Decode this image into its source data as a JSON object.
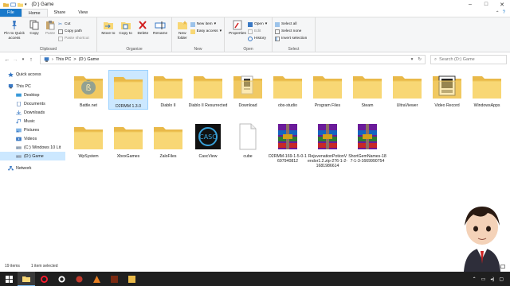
{
  "window": {
    "title": "(D:) Game",
    "drive_label": "(D:) Game"
  },
  "tabs": [
    "File",
    "Home",
    "Share",
    "View"
  ],
  "ribbon": {
    "clipboard": {
      "label": "Clipboard",
      "pin": "Pin to Quick access",
      "copy": "Copy",
      "paste": "Paste",
      "cut": "Cut",
      "copy_path": "Copy path",
      "paste_shortcut": "Paste shortcut"
    },
    "organize": {
      "label": "Organize",
      "move_to": "Move to",
      "copy_to": "Copy to",
      "delete": "Delete",
      "rename": "Rename"
    },
    "new": {
      "label": "New",
      "new_folder": "New folder",
      "new_item": "New item",
      "easy_access": "Easy access"
    },
    "open": {
      "label": "Open",
      "properties": "Properties",
      "open": "Open",
      "edit": "Edit",
      "history": "History"
    },
    "select": {
      "label": "Select",
      "select_all": "Select all",
      "select_none": "Select none",
      "invert": "Invert selection"
    }
  },
  "address": {
    "path": [
      "This PC",
      "(D:) Game"
    ],
    "separator": ">"
  },
  "search": {
    "placeholder": "Search (D:) Game"
  },
  "nav": {
    "items": [
      {
        "label": "Quick access",
        "icon": "star-icon",
        "indent": 0
      },
      {
        "label": "This PC",
        "icon": "computer-icon",
        "indent": 0
      },
      {
        "label": "Desktop",
        "icon": "desktop-icon",
        "indent": 1
      },
      {
        "label": "Documents",
        "icon": "documents-icon",
        "indent": 1
      },
      {
        "label": "Downloads",
        "icon": "downloads-icon",
        "indent": 1
      },
      {
        "label": "Music",
        "icon": "music-icon",
        "indent": 1
      },
      {
        "label": "Pictures",
        "icon": "pictures-icon",
        "indent": 1
      },
      {
        "label": "Videos",
        "icon": "videos-icon",
        "indent": 1
      },
      {
        "label": "(C:) Windows 10 Lit",
        "icon": "drive-icon",
        "indent": 1
      },
      {
        "label": "(D:) Game",
        "icon": "drive-icon",
        "indent": 1,
        "selected": true
      },
      {
        "label": "Network",
        "icon": "network-icon",
        "indent": 0
      }
    ]
  },
  "files": [
    {
      "name": "Battle.net",
      "type": "folder",
      "overlay": "battlenet"
    },
    {
      "name": "D2RMM 1.3.0",
      "type": "folder",
      "selected": true
    },
    {
      "name": "Diablo II",
      "type": "folder"
    },
    {
      "name": "Diablo II Resurrected",
      "type": "folder"
    },
    {
      "name": "Download",
      "type": "folder",
      "overlay": "docs"
    },
    {
      "name": "obs-studio",
      "type": "folder"
    },
    {
      "name": "Program Files",
      "type": "folder"
    },
    {
      "name": "Steam",
      "type": "folder"
    },
    {
      "name": "UltraViewer",
      "type": "folder"
    },
    {
      "name": "Video Record",
      "type": "folder",
      "overlay": "video"
    },
    {
      "name": "WindowsApps",
      "type": "folder"
    },
    {
      "name": "WpSystem",
      "type": "folder"
    },
    {
      "name": "XboxGames",
      "type": "folder"
    },
    {
      "name": "ZaloFiles",
      "type": "folder"
    },
    {
      "name": "CascView",
      "type": "app",
      "badge": "CASC"
    },
    {
      "name": "cube",
      "type": "file"
    },
    {
      "name": "D2RMM-169-1-5-0-1697940812",
      "type": "archive"
    },
    {
      "name": "RejuvenationPotionVendor1.2.zip-276-1-2-1681986614",
      "type": "archive"
    },
    {
      "name": "ShortGemNames-187-1-3-1669990754",
      "type": "archive"
    }
  ],
  "status": {
    "count": "19 items",
    "selected": "1 item selected"
  },
  "colors": {
    "accent": "#1979ca",
    "folder": "#f8d775",
    "folder_dark": "#e9b949",
    "selection": "#cce8ff"
  }
}
